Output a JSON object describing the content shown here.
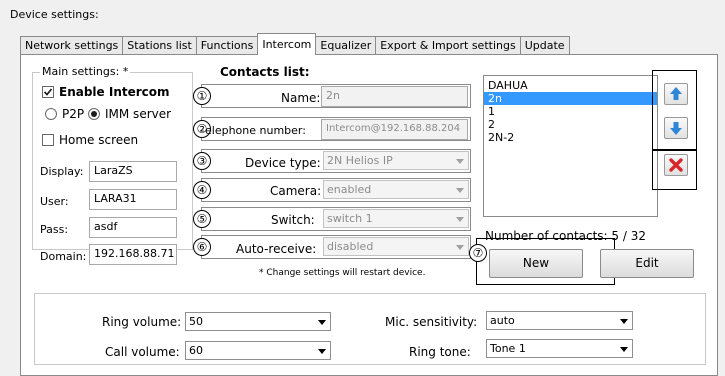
{
  "group_title": "Device settings:",
  "tabs": [
    "Network settings",
    "Stations list",
    "Functions",
    "Intercom",
    "Equalizer",
    "Export & Import settings",
    "Update"
  ],
  "active_tab": "Intercom",
  "main": {
    "title": "Main settings: *",
    "enable_intercom": "Enable Intercom",
    "p2p": "P2P",
    "imm_server": "IMM server",
    "home_screen": "Home screen",
    "display_label": "Display:",
    "display_value": "LaraZS",
    "user_label": "User:",
    "user_value": "LARA31",
    "pass_label": "Pass:",
    "pass_value": "asdf",
    "domain_label": "Domain:",
    "domain_value": "192.168.88.71"
  },
  "contacts": {
    "title": "Contacts list:",
    "name_label": "Name:",
    "name_value": "2n",
    "phone_label": "elephone number:",
    "phone_value": "Intercom@192.168.88.204",
    "device_label": "Device type:",
    "device_value": "2N Helios IP",
    "camera_label": "Camera:",
    "camera_value": "enabled",
    "switch_label": "Switch:",
    "switch_value": "switch 1",
    "auto_label": "Auto-receive:",
    "auto_value": "disabled",
    "note": "* Change settings will restart device.",
    "list": [
      "DAHUA",
      "2n",
      "1",
      "2",
      "2N-2"
    ],
    "selected": "2n",
    "count_text": "Number of contacts: 5 / 32",
    "new_btn": "New",
    "edit_btn": "Edit",
    "markers": [
      "①",
      "②",
      "③",
      "④",
      "⑤",
      "⑥",
      "⑦"
    ]
  },
  "audio": {
    "ring_volume_label": "Ring volume:",
    "ring_volume_value": "50",
    "call_volume_label": "Call volume:",
    "call_volume_value": "60",
    "mic_label": "Mic. sensitivity:",
    "mic_value": "auto",
    "ring_tone_label": "Ring tone:",
    "ring_tone_value": "Tone 1"
  },
  "colors": {
    "selection": "#3399ff",
    "arrow_blue": "#2f86d6",
    "delete_red": "#d9262b"
  }
}
